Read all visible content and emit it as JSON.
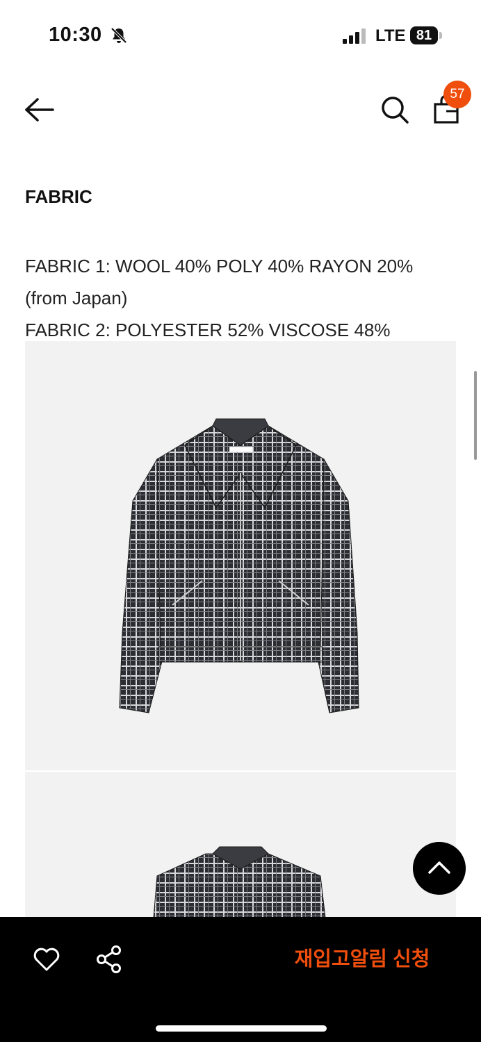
{
  "status_bar": {
    "time": "10:30",
    "network": "LTE",
    "battery": "81"
  },
  "nav": {
    "back_icon": "arrow-left-icon",
    "search_icon": "search-icon",
    "bag_icon": "shopping-bag-icon",
    "cart_count": "57"
  },
  "content": {
    "section_title": "FABRIC",
    "fabric_line_1": "FABRIC 1: WOOL 40% POLY 40% RAYON 20%",
    "fabric_line_2": "(from Japan)",
    "fabric_line_3": "FABRIC 2: POLYESTER 52% VISCOSE 48%"
  },
  "bottom_bar": {
    "wishlist_icon": "heart-icon",
    "share_icon": "share-icon",
    "restock_label": "재입고알림 신청"
  },
  "colors": {
    "accent": "#f04e0c",
    "background": "#ffffff",
    "bottom_bar": "#000000"
  }
}
